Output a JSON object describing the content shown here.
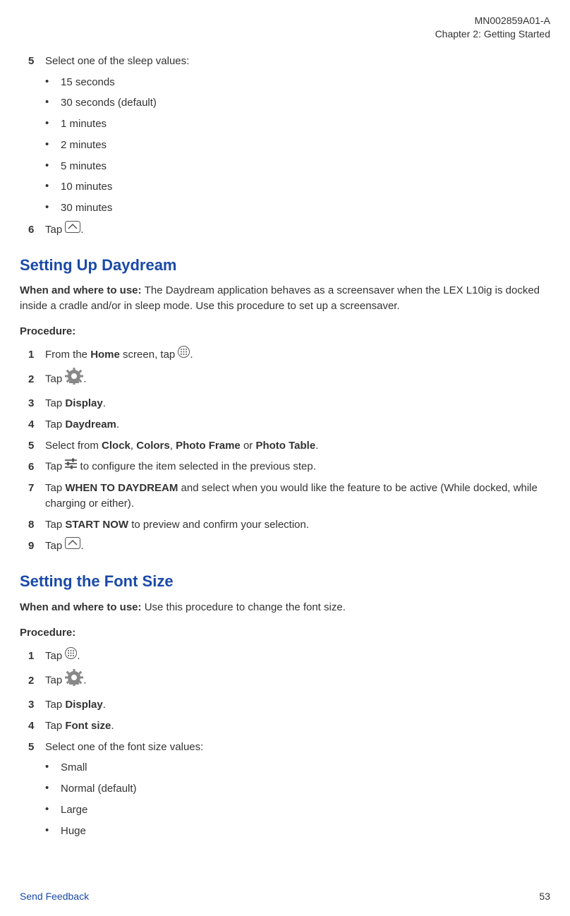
{
  "header": {
    "doc_id": "MN002859A01-A",
    "chapter": "Chapter 2:  Getting Started"
  },
  "section0": {
    "step5_num": "5",
    "step5_txt": "Select one of the sleep values:",
    "sleep_values": [
      "15 seconds",
      "30 seconds (default)",
      "1 minutes",
      "2 minutes",
      "5 minutes",
      "10 minutes",
      "30 minutes"
    ],
    "step6_num": "6",
    "step6_tap": "Tap",
    "step6_period": "."
  },
  "daydream": {
    "title": "Setting Up Daydream",
    "when_label": "When and where to use: ",
    "when_text": "The Daydream application behaves as a screensaver when the LEX L10ig is docked inside a cradle and/or in sleep mode. Use this procedure to set up a screensaver.",
    "procedure_label": "Procedure:",
    "step1_num": "1",
    "step1_a": "From the ",
    "step1_home": "Home",
    "step1_b": " screen, tap ",
    "step1_period": ".",
    "step2_num": "2",
    "step2_tap": "Tap",
    "step2_period": ".",
    "step3_num": "3",
    "step3_a": "Tap ",
    "step3_display": "Display",
    "step3_b": ".",
    "step4_num": "4",
    "step4_a": "Tap ",
    "step4_daydream": "Daydream",
    "step4_b": ".",
    "step5_num": "5",
    "step5_a": "Select from ",
    "step5_clock": "Clock",
    "step5_c1": ", ",
    "step5_colors": "Colors",
    "step5_c2": ", ",
    "step5_photoframe": "Photo Frame",
    "step5_or": " or ",
    "step5_phototable": "Photo Table",
    "step5_b": ".",
    "step6_num": "6",
    "step6_tap": "Tap",
    "step6_txt": " to configure the item selected in the previous step.",
    "step7_num": "7",
    "step7_a": "Tap ",
    "step7_when": "WHEN TO DAYDREAM",
    "step7_b": " and select when you would like the feature to be active (While docked, while charging or either).",
    "step8_num": "8",
    "step8_a": "Tap ",
    "step8_start": "START NOW",
    "step8_b": " to preview and confirm your selection.",
    "step9_num": "9",
    "step9_tap": "Tap",
    "step9_period": "."
  },
  "fontsize": {
    "title": "Setting the Font Size",
    "when_label": "When and where to use: ",
    "when_text": "Use this procedure to change the font size.",
    "procedure_label": "Procedure:",
    "step1_num": "1",
    "step1_tap": "Tap",
    "step1_period": ".",
    "step2_num": "2",
    "step2_tap": "Tap",
    "step2_period": ".",
    "step3_num": "3",
    "step3_a": "Tap ",
    "step3_display": "Display",
    "step3_b": ".",
    "step4_num": "4",
    "step4_a": "Tap ",
    "step4_font": "Font size",
    "step4_b": ".",
    "step5_num": "5",
    "step5_txt": "Select one of the font size values:",
    "font_values": [
      "Small",
      "Normal (default)",
      "Large",
      "Huge"
    ]
  },
  "footer": {
    "feedback": "Send Feedback",
    "page": "53"
  }
}
